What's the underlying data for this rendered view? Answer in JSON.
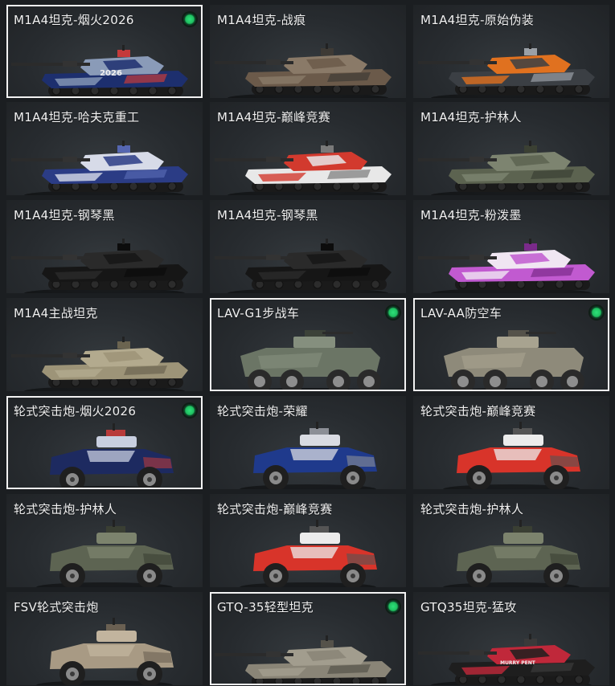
{
  "status_color": "#22c86a",
  "selected_border_color": "#f2f2f2",
  "items": [
    {
      "name": "M1A4坦克-烟火2026",
      "type": "tank",
      "colors": [
        "#1d2f6e",
        "#8a9bb8",
        "#c43a3a"
      ],
      "decal": "2026",
      "selected": true,
      "equipped": true
    },
    {
      "name": "M1A4坦克-战痕",
      "type": "tank",
      "colors": [
        "#6b5a4a",
        "#8a7a68",
        "#3e3a35"
      ],
      "selected": false,
      "equipped": false
    },
    {
      "name": "M1A4坦克-原始伪装",
      "type": "tank",
      "colors": [
        "#3b3f44",
        "#e0711f",
        "#9aa0a6"
      ],
      "selected": false,
      "equipped": false
    },
    {
      "name": "M1A4坦克-哈夫克重工",
      "type": "tank",
      "colors": [
        "#2b3c85",
        "#d7dbe8",
        "#5566b0"
      ],
      "selected": false,
      "equipped": false
    },
    {
      "name": "M1A4坦克-巅峰竞赛",
      "type": "tank",
      "colors": [
        "#e8e8e8",
        "#d23a2e",
        "#7a7a7a"
      ],
      "selected": false,
      "equipped": false
    },
    {
      "name": "M1A4坦克-护林人",
      "type": "tank",
      "colors": [
        "#5c6350",
        "#7d8470",
        "#3b4033"
      ],
      "selected": false,
      "equipped": false
    },
    {
      "name": "M1A4坦克-钢琴黑",
      "type": "tank",
      "colors": [
        "#161616",
        "#2a2a2a",
        "#0c0c0c"
      ],
      "selected": false,
      "equipped": false
    },
    {
      "name": "M1A4坦克-钢琴黑",
      "type": "tank",
      "colors": [
        "#161616",
        "#2a2a2a",
        "#0c0c0c"
      ],
      "selected": false,
      "equipped": false
    },
    {
      "name": "M1A4坦克-粉泼墨",
      "type": "tank",
      "colors": [
        "#c15ad0",
        "#f0e6f2",
        "#7a2a8a"
      ],
      "selected": false,
      "equipped": false
    },
    {
      "name": "M1A4主战坦克",
      "type": "tank",
      "colors": [
        "#9d9478",
        "#b3aa8e",
        "#6b6450"
      ],
      "selected": false,
      "equipped": false
    },
    {
      "name": "LAV-G1步战车",
      "type": "apc",
      "colors": [
        "#6b7565",
        "#858f7e",
        "#3c4239"
      ],
      "selected": true,
      "equipped": true
    },
    {
      "name": "LAV-AA防空车",
      "type": "apc",
      "colors": [
        "#8e8a7a",
        "#a8a390",
        "#55524a"
      ],
      "selected": true,
      "equipped": true
    },
    {
      "name": "轮式突击炮-烟火2026",
      "type": "wheeled",
      "colors": [
        "#1d2a60",
        "#c8cfe0",
        "#b83a3a"
      ],
      "selected": true,
      "equipped": true
    },
    {
      "name": "轮式突击炮-荣耀",
      "type": "wheeled",
      "colors": [
        "#1f3a8c",
        "#d9dbe2",
        "#8c8f96"
      ],
      "selected": false,
      "equipped": false
    },
    {
      "name": "轮式突击炮-巅峰竞赛",
      "type": "wheeled",
      "colors": [
        "#d8342a",
        "#ececec",
        "#555555"
      ],
      "selected": false,
      "equipped": false
    },
    {
      "name": "轮式突击炮-护林人",
      "type": "wheeled",
      "colors": [
        "#5d6452",
        "#7c836d",
        "#3a3f33"
      ],
      "selected": false,
      "equipped": false
    },
    {
      "name": "轮式突击炮-巅峰竞赛",
      "type": "wheeled",
      "colors": [
        "#d8342a",
        "#ececec",
        "#555555"
      ],
      "selected": false,
      "equipped": false
    },
    {
      "name": "轮式突击炮-护林人",
      "type": "wheeled",
      "colors": [
        "#5d6452",
        "#7c836d",
        "#3a3f33"
      ],
      "selected": false,
      "equipped": false
    },
    {
      "name": "FSV轮式突击炮",
      "type": "wheeled",
      "colors": [
        "#a89a84",
        "#c2b49e",
        "#6a6052"
      ],
      "selected": false,
      "equipped": false
    },
    {
      "name": "GTQ-35轻型坦克",
      "type": "light_tank",
      "colors": [
        "#8a8577",
        "#a29d8e",
        "#55524a"
      ],
      "selected": true,
      "equipped": true
    },
    {
      "name": "GTQ35坦克-猛攻",
      "type": "light_tank",
      "colors": [
        "#1e1e1e",
        "#c0283a",
        "#3a3a3a"
      ],
      "decal": "MURRY PENT",
      "selected": false,
      "equipped": false
    }
  ]
}
